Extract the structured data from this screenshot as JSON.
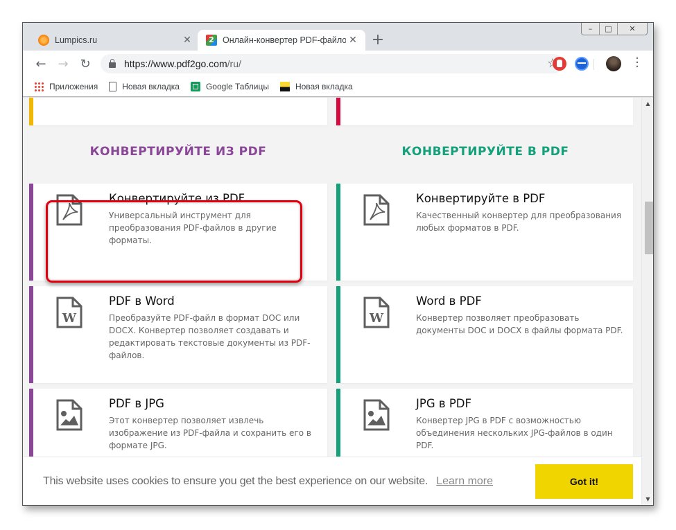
{
  "browser": {
    "tabs": [
      {
        "title": "Lumpics.ru",
        "active": false,
        "favicon": "orange-icon"
      },
      {
        "title": "Онлайн-конвертер PDF-файлов",
        "active": true,
        "favicon": "pdf2go-icon",
        "favicon_text": "2"
      }
    ],
    "new_tab_label": "+",
    "window_controls": {
      "minimize": "–",
      "maximize": "□",
      "close": "✕"
    },
    "nav": {
      "back": "←",
      "forward": "→",
      "reload": "↻"
    },
    "url": {
      "host": "https://www.pdf2go.com",
      "path": "/ru/"
    },
    "star": "☆",
    "menu": "⋮",
    "bookmarks": [
      {
        "label": "Приложения",
        "icon": "apps-icon"
      },
      {
        "label": "Новая вкладка",
        "icon": "page-icon"
      },
      {
        "label": "Google Таблицы",
        "icon": "sheets-icon"
      },
      {
        "label": "Новая вкладка",
        "icon": "image-icon"
      }
    ]
  },
  "page": {
    "colors": {
      "from_pdf": "#8a4697",
      "to_pdf": "#13a07a",
      "top_left_accent": "#f2b705",
      "top_right_accent": "#d9083e",
      "highlight": "#e3000f",
      "cookie_button": "#f0d500"
    },
    "top_partial_text": "...",
    "sections": {
      "from_pdf_title": "КОНВЕРТИРУЙТЕ ИЗ PDF",
      "to_pdf_title": "КОНВЕРТИРУЙТЕ В PDF"
    },
    "cards_left": [
      {
        "title": "Конвертируйте из PDF",
        "desc": "Универсальный инструмент для преобразования PDF-файлов в другие форматы.",
        "icon": "pdf-file-icon"
      },
      {
        "title": "PDF в Word",
        "desc": "Преобразуйте PDF-файл в формат DOC или DOCX. Конвертер позволяет создавать и редактировать текстовые документы из PDF-файлов.",
        "icon": "word-file-icon"
      },
      {
        "title": "PDF в JPG",
        "desc": "Этот конвертер позволяет извлечь изображение из PDF-файла и сохранить его в формате JPG.",
        "icon": "image-file-icon"
      }
    ],
    "cards_right": [
      {
        "title": "Конвертируйте в PDF",
        "desc": "Качественный конвертер для преобразования любых форматов в PDF.",
        "icon": "pdf-file-icon"
      },
      {
        "title": "Word в PDF",
        "desc": "Конвертер позволяет преобразовать документы DOC и DOCX в файлы формата PDF.",
        "icon": "word-file-icon"
      },
      {
        "title": "JPG в PDF",
        "desc": "Конвертер JPG в PDF с возможностью объединения нескольких JPG-файлов в один PDF.",
        "icon": "image-file-icon"
      }
    ],
    "cookie": {
      "text": "This website uses cookies to ensure you get the best experience on our website.",
      "link": "Learn more",
      "button": "Got it!"
    },
    "scrollbar": {
      "up": "▲",
      "down": "▼"
    }
  }
}
